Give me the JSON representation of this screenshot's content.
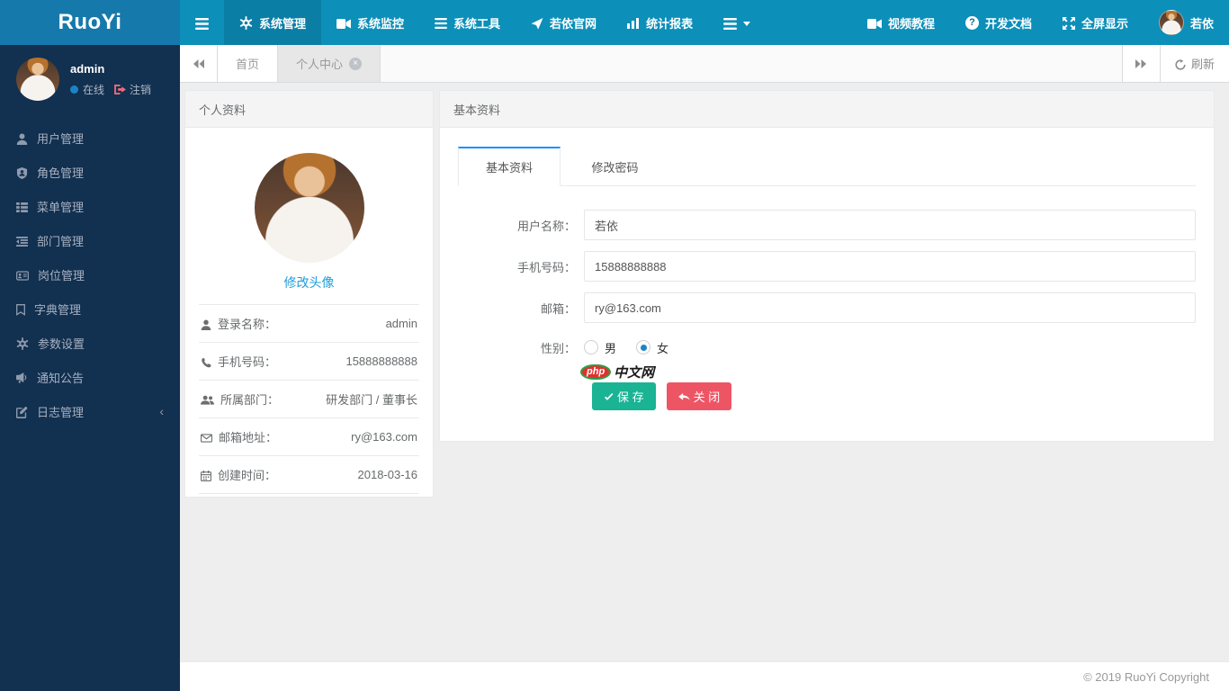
{
  "navbar": {
    "logo": "RuoYi",
    "menu": [
      {
        "icon": "gear-icon",
        "label": "系统管理",
        "active": true
      },
      {
        "icon": "video-icon",
        "label": "系统监控",
        "active": false
      },
      {
        "icon": "list-icon",
        "label": "系统工具",
        "active": false
      },
      {
        "icon": "paper-plane-icon",
        "label": "若依官网",
        "active": false
      },
      {
        "icon": "bar-chart-icon",
        "label": "统计报表",
        "active": false
      }
    ],
    "right": [
      {
        "icon": "video-icon",
        "label": "视频教程"
      },
      {
        "icon": "question-icon",
        "label": "开发文档"
      },
      {
        "icon": "fullscreen-icon",
        "label": "全屏显示"
      },
      {
        "icon": "avatar",
        "label": "若依"
      }
    ]
  },
  "sidebar": {
    "username": "admin",
    "status": "在线",
    "logout": "注销",
    "menu": [
      {
        "icon": "user-icon",
        "label": "用户管理"
      },
      {
        "icon": "role-icon",
        "label": "角色管理"
      },
      {
        "icon": "menu-list-icon",
        "label": "菜单管理"
      },
      {
        "icon": "dept-icon",
        "label": "部门管理"
      },
      {
        "icon": "post-icon",
        "label": "岗位管理"
      },
      {
        "icon": "dict-icon",
        "label": "字典管理"
      },
      {
        "icon": "config-icon",
        "label": "参数设置"
      },
      {
        "icon": "notice-icon",
        "label": "通知公告"
      },
      {
        "icon": "log-icon",
        "label": "日志管理"
      }
    ]
  },
  "tabbar": {
    "tabs": [
      {
        "label": "首页",
        "active": false,
        "closable": false
      },
      {
        "label": "个人中心",
        "active": true,
        "closable": true
      }
    ],
    "refresh_label": "刷新"
  },
  "profile_panel": {
    "title": "个人资料",
    "change_avatar_label": "修改头像",
    "fields": [
      {
        "icon": "user-icon",
        "label": "登录名称：",
        "value": "admin"
      },
      {
        "icon": "phone-icon",
        "label": "手机号码：",
        "value": "15888888888"
      },
      {
        "icon": "users-icon",
        "label": "所属部门：",
        "value": "研发部门 / 董事长"
      },
      {
        "icon": "envelope-icon",
        "label": "邮箱地址：",
        "value": "ry@163.com"
      },
      {
        "icon": "calendar-icon",
        "label": "创建时间：",
        "value": "2018-03-16"
      }
    ]
  },
  "detail_panel": {
    "title": "基本资料",
    "tabs": [
      {
        "label": "基本资料",
        "active": true
      },
      {
        "label": "修改密码",
        "active": false
      }
    ],
    "form": {
      "username": {
        "label": "用户名称：",
        "value": "若依"
      },
      "phone": {
        "label": "手机号码：",
        "value": "15888888888"
      },
      "email": {
        "label": "邮箱：",
        "value": "ry@163.com"
      },
      "gender": {
        "label": "性别：",
        "options": [
          {
            "label": "男",
            "checked": false
          },
          {
            "label": "女",
            "checked": true
          }
        ]
      }
    },
    "watermark": {
      "php": "php",
      "cn": "中文网"
    },
    "buttons": {
      "save": "保 存",
      "close": "关 闭"
    }
  },
  "footer": {
    "copyright": "© 2019 RuoYi Copyright"
  },
  "colors": {
    "navbar_bg": "#0c8fb9",
    "navbar_active_bg": "#0b7ea5",
    "logo_bg": "#1679ab",
    "sidebar_bg": "#12304f",
    "tab_active_border": "#1890ff",
    "link_blue": "#1e9dd8",
    "online_dot": "#1c84c6",
    "save_green": "#1ab394",
    "close_red": "#ed5565",
    "panel_border": "#e7eaec"
  }
}
